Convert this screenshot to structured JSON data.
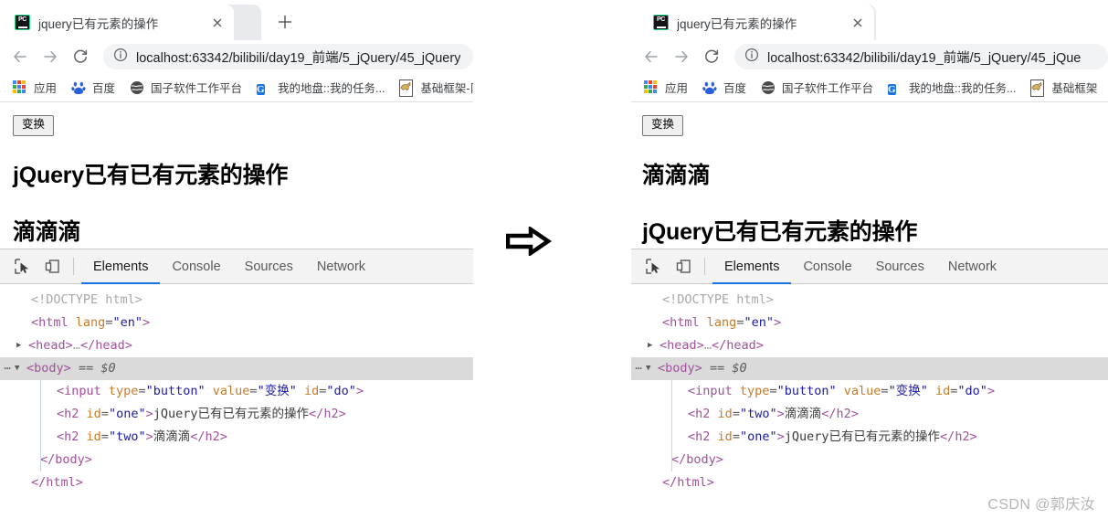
{
  "meta": {
    "watermark": "CSDN @郭庆汝",
    "arrow_icon": "right-arrow-icon"
  },
  "browsers": [
    {
      "id": "before",
      "tab": {
        "title": "jquery已有元素的操作",
        "favicon_label": "PC",
        "favicon_name": "phpstorm-favicon",
        "close_label": "×",
        "newtab_label": "+"
      },
      "toolbar": {
        "back_label": "←",
        "forward_label": "→",
        "reload_label": "⟳",
        "info_label": "ⓘ",
        "url_host": "localhost:63342",
        "url_path": "/bilibili/day19_前端/5_jQuery/45_jQuery",
        "url_full": "localhost:63342/bilibili/day19_前端/5_jQuery/45_jQuery"
      },
      "bookmarks": [
        {
          "label": "应用",
          "icon": "apps-grid-icon"
        },
        {
          "label": "百度",
          "icon": "baidu-paw-icon"
        },
        {
          "label": "国子软件工作平台",
          "icon": "globe-icon"
        },
        {
          "label": "我的地盘::我的任务...",
          "icon": "google-g-icon"
        },
        {
          "label": "基础框架-阝",
          "icon": "mule-icon"
        }
      ],
      "page": {
        "button_label": "变换",
        "headings": [
          "jQuery已有已有元素的操作",
          "滴滴滴"
        ]
      },
      "devtools": {
        "inspect_icon": "inspect-element-icon",
        "device_icon": "device-toolbar-icon",
        "tabs": [
          {
            "label": "Elements",
            "active": true
          },
          {
            "label": "Console",
            "active": false
          },
          {
            "label": "Sources",
            "active": false
          },
          {
            "label": "Network",
            "active": false
          }
        ],
        "dom_lines": [
          {
            "kind": "doctype",
            "text": "<!DOCTYPE html>"
          },
          {
            "kind": "open",
            "tag": "html",
            "attrs": [
              {
                "name": "lang",
                "value": "en"
              }
            ]
          },
          {
            "kind": "collapsed",
            "tag": "head",
            "triangle": "▶",
            "text": "…"
          },
          {
            "kind": "selected",
            "tag": "body",
            "triangle": "▼",
            "suffix": "== $0",
            "dots": "⋯"
          },
          {
            "kind": "void",
            "tag": "input",
            "attrs": [
              {
                "name": "type",
                "value": "button"
              },
              {
                "name": "value",
                "value": "变换"
              },
              {
                "name": "id",
                "value": "do"
              }
            ]
          },
          {
            "kind": "element",
            "tag": "h2",
            "attrs": [
              {
                "name": "id",
                "value": "one"
              }
            ],
            "text": "jQuery已有已有元素的操作"
          },
          {
            "kind": "element",
            "tag": "h2",
            "attrs": [
              {
                "name": "id",
                "value": "two"
              }
            ],
            "text": "滴滴滴"
          },
          {
            "kind": "close",
            "tag": "body"
          },
          {
            "kind": "close-root",
            "tag": "html"
          }
        ]
      }
    },
    {
      "id": "after",
      "tab": {
        "title": "jquery已有元素的操作",
        "favicon_label": "PC",
        "favicon_name": "phpstorm-favicon",
        "close_label": "×",
        "newtab_label": ""
      },
      "toolbar": {
        "back_label": "←",
        "forward_label": "→",
        "reload_label": "⟳",
        "info_label": "ⓘ",
        "url_host": "localhost:63342",
        "url_path": "/bilibili/day19_前端/5_jQuery/45_jQue",
        "url_full": "localhost:63342/bilibili/day19_前端/5_jQuery/45_jQue"
      },
      "bookmarks": [
        {
          "label": "应用",
          "icon": "apps-grid-icon"
        },
        {
          "label": "百度",
          "icon": "baidu-paw-icon"
        },
        {
          "label": "国子软件工作平台",
          "icon": "globe-icon"
        },
        {
          "label": "我的地盘::我的任务...",
          "icon": "google-g-icon"
        },
        {
          "label": "基础框架",
          "icon": "mule-icon"
        }
      ],
      "page": {
        "button_label": "变换",
        "headings": [
          "滴滴滴",
          "jQuery已有已有元素的操作"
        ]
      },
      "devtools": {
        "inspect_icon": "inspect-element-icon",
        "device_icon": "device-toolbar-icon",
        "tabs": [
          {
            "label": "Elements",
            "active": true
          },
          {
            "label": "Console",
            "active": false
          },
          {
            "label": "Sources",
            "active": false
          },
          {
            "label": "Network",
            "active": false
          }
        ],
        "dom_lines": [
          {
            "kind": "doctype",
            "text": "<!DOCTYPE html>"
          },
          {
            "kind": "open",
            "tag": "html",
            "attrs": [
              {
                "name": "lang",
                "value": "en"
              }
            ]
          },
          {
            "kind": "collapsed",
            "tag": "head",
            "triangle": "▶",
            "text": "…"
          },
          {
            "kind": "selected",
            "tag": "body",
            "triangle": "▼",
            "suffix": "== $0",
            "dots": "⋯"
          },
          {
            "kind": "void",
            "tag": "input",
            "attrs": [
              {
                "name": "type",
                "value": "button"
              },
              {
                "name": "value",
                "value": "变换"
              },
              {
                "name": "id",
                "value": "do"
              }
            ]
          },
          {
            "kind": "element",
            "tag": "h2",
            "attrs": [
              {
                "name": "id",
                "value": "two"
              }
            ],
            "text": "滴滴滴"
          },
          {
            "kind": "element",
            "tag": "h2",
            "attrs": [
              {
                "name": "id",
                "value": "one"
              }
            ],
            "text": "jQuery已有已有元素的操作"
          },
          {
            "kind": "close",
            "tag": "body"
          },
          {
            "kind": "close-root",
            "tag": "html"
          }
        ]
      }
    }
  ],
  "colors": {
    "accent_blue": "#1a73e8",
    "tag_purple": "#a0519a",
    "attr_orange": "#c77b29",
    "value_blue": "#1a1aa6",
    "selected_row": "#dadada",
    "favicon_green": "#21d789"
  }
}
